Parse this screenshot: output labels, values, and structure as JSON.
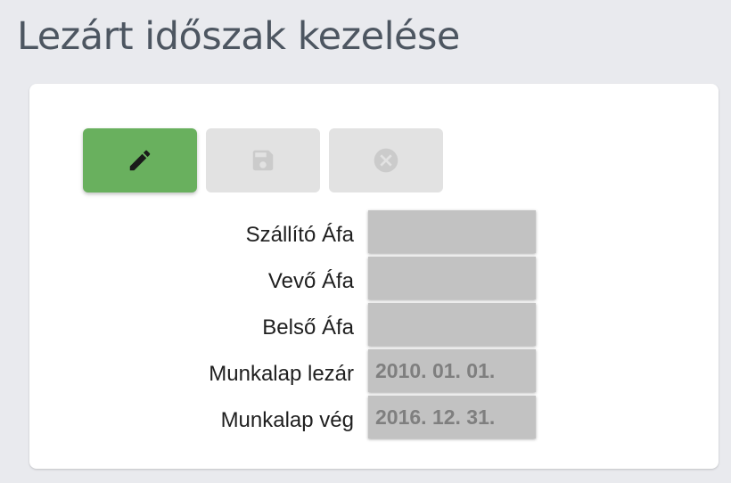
{
  "page": {
    "title": "Lezárt időszak kezelése"
  },
  "toolbar": {
    "edit_icon": "pencil-icon",
    "save_icon": "floppy-disk-icon",
    "cancel_icon": "close-circle-icon",
    "colors": {
      "edit_bg": "#69b05e",
      "disabled_bg": "#e2e2e2"
    }
  },
  "form": {
    "fields": [
      {
        "label": "Szállító Áfa",
        "value": ""
      },
      {
        "label": "Vevő Áfa",
        "value": ""
      },
      {
        "label": "Belső Áfa",
        "value": ""
      },
      {
        "label": "Munkalap lezár",
        "value": "2010. 01. 01."
      },
      {
        "label": "Munkalap vég",
        "value": "2016. 12. 31."
      }
    ]
  }
}
